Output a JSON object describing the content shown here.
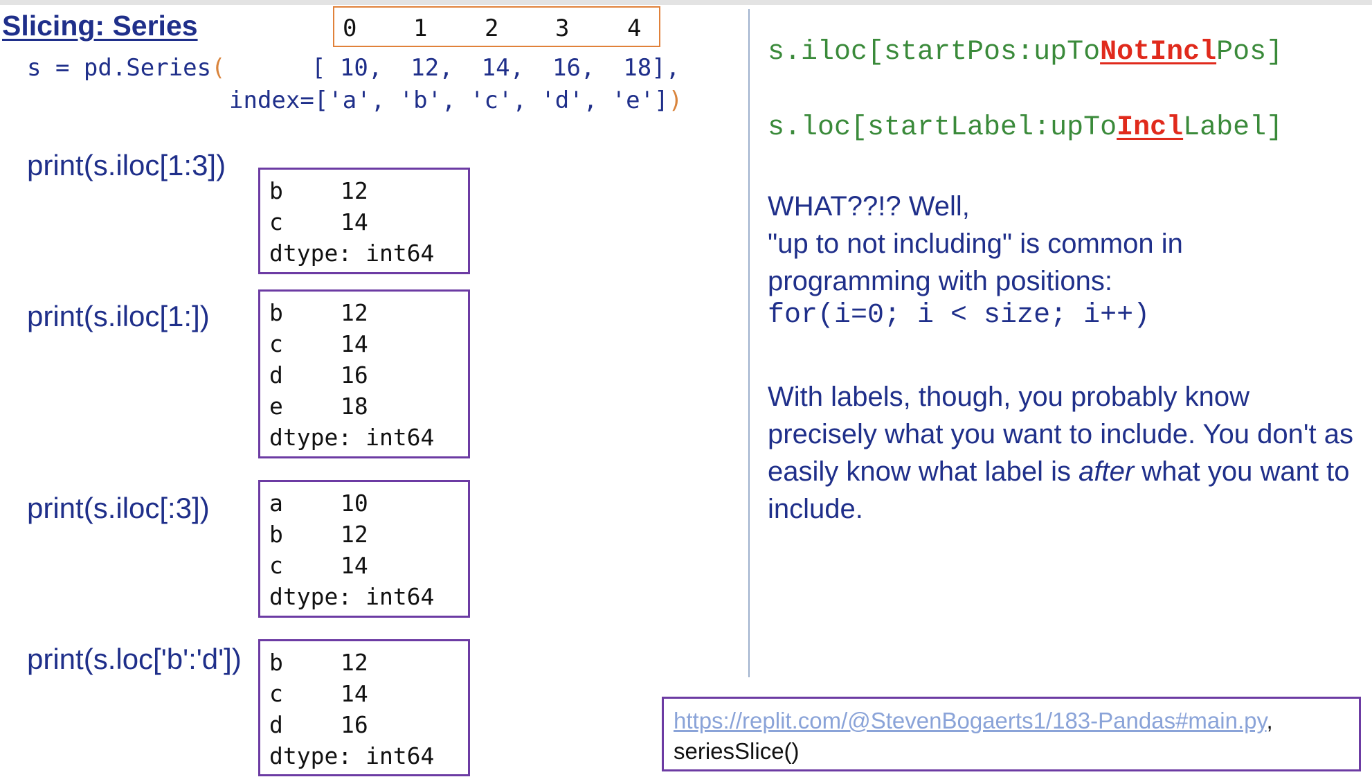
{
  "slide": {
    "title": "Slicing: Series",
    "positions": [
      "0",
      "1",
      "2",
      "3",
      "4"
    ],
    "code": {
      "line1_prefix": "s = pd.Series",
      "open_paren": "(",
      "line1_values": "[ 10,  12,  14,  16,  18],",
      "line2_index": "index=['a', 'b', 'c', 'd', 'e']",
      "close_paren": ")"
    },
    "examples": [
      {
        "call": "print(s.iloc[1:3])",
        "rows": [
          {
            "label": "b",
            "value": "12"
          },
          {
            "label": "c",
            "value": "14"
          }
        ],
        "dtype": "dtype: int64"
      },
      {
        "call": "print(s.iloc[1:])",
        "rows": [
          {
            "label": "b",
            "value": "12"
          },
          {
            "label": "c",
            "value": "14"
          },
          {
            "label": "d",
            "value": "16"
          },
          {
            "label": "e",
            "value": "18"
          }
        ],
        "dtype": "dtype: int64"
      },
      {
        "call": "print(s.iloc[:3])",
        "rows": [
          {
            "label": "a",
            "value": "10"
          },
          {
            "label": "b",
            "value": "12"
          },
          {
            "label": "c",
            "value": "14"
          }
        ],
        "dtype": "dtype: int64"
      },
      {
        "call": "print(s.loc['b':'d'])",
        "rows": [
          {
            "label": "b",
            "value": "12"
          },
          {
            "label": "c",
            "value": "14"
          },
          {
            "label": "d",
            "value": "16"
          }
        ],
        "dtype": "dtype: int64"
      }
    ],
    "syntax": {
      "iloc_prefix": "s.iloc[startPos:upTo",
      "iloc_emphasis": "NotIncl",
      "iloc_suffix": "Pos]",
      "loc_prefix": "s.loc[startLabel:upTo",
      "loc_emphasis": "Incl",
      "loc_suffix": "Label]"
    },
    "explanation": {
      "line1": "WHAT??!? Well,",
      "line2": "\"up to not including\" is common in",
      "line3": "programming with positions:",
      "loop_code": "for(i=0; i < size; i++)",
      "para2_part1": "With labels, though, you probably know precisely what you want to include. You don't as easily know what label is ",
      "para2_italic": "after",
      "para2_part2": " what you want to include."
    },
    "reference": {
      "url": "https://replit.com/@StevenBogaerts1/183-Pandas#main.py",
      "trailing_comma": ",",
      "function": "seriesSlice()"
    },
    "colors": {
      "text_blue": "#1f2f8a",
      "code_green": "#3a8a3a",
      "emphasis_red": "#e02a1c",
      "box_purple": "#6c3ba3",
      "box_orange": "#e0813a"
    }
  }
}
